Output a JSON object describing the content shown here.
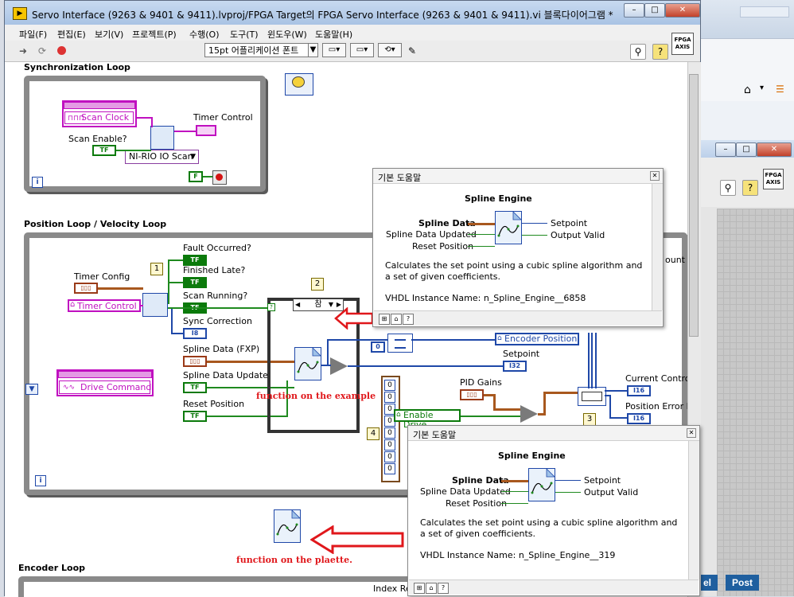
{
  "window": {
    "title": "Servo Interface (9263 & 9401 & 9411).lvproj/FPGA Target의 FPGA Servo Interface (9263 & 9401 & 9411).vi 블록다이어그램 *"
  },
  "menu": [
    "파일(F)",
    "편집(E)",
    "보기(V)",
    "프로젝트(P)",
    "수행(O)",
    "도구(T)",
    "윈도우(W)",
    "도움말(H)"
  ],
  "toolbar": {
    "font": "15pt 어플리케이션 폰트",
    "fpga_badge": "FPGA AXIS"
  },
  "sync_loop": {
    "label": "Synchronization Loop",
    "scan_clock": "Scan Clock",
    "timer_control": "Timer Control",
    "scan_enable": "Scan Enable?",
    "scan_mode": "NI-RIO IO Scan",
    "tf": "TF",
    "f": "F",
    "iter": "i"
  },
  "position_loop": {
    "label": "Position Loop / Velocity Loop",
    "timer_config": "Timer Config",
    "timer_control": "Timer Control",
    "drive_command": "Drive Command",
    "fault_occurred": "Fault Occurred?",
    "finished_late": "Finished Late?",
    "scan_running": "Scan Running?",
    "sync_correction": "Sync Correction",
    "spline_data_fxp": "Spline Data (FXP)",
    "spline_data_updated": "Spline Data Updated",
    "reset_position": "Reset Position",
    "case_selector": "참",
    "frame1": "1",
    "frame2": "2",
    "frame3": "3",
    "frame4": "4",
    "zero": "0",
    "encoder_position": "Encoder Position",
    "setpoint": "Setpoint",
    "pid_gains": "PID Gains",
    "enable_drive": "Enable Drive",
    "current_control": "Current Contro",
    "position_error": "Position Error I",
    "count": "ount",
    "i16": "I16",
    "i32": "I32",
    "i8": "I8",
    "tf": "TF",
    "iter": "i",
    "array_values": [
      "0",
      "0",
      "0",
      "0",
      "0",
      "0",
      "0",
      "0"
    ]
  },
  "annotations": {
    "example": "function on the example",
    "palette": "function on the plaette."
  },
  "encoder_loop": {
    "label": "Encoder Loop",
    "index_reset": "Index Re"
  },
  "help1": {
    "title": "기본 도움말",
    "function": "Spline Engine",
    "inputs": [
      "Spline Data",
      "Spline Data Updated",
      "Reset Position"
    ],
    "outputs": [
      "Setpoint",
      "Output Valid"
    ],
    "description": "Calculates the set point using a cubic spline algorithm and a set of given coefficients.",
    "instance": "VHDL Instance Name: n_Spline_Engine__6858"
  },
  "help2": {
    "title": "기본 도움말",
    "function": "Spline Engine",
    "inputs": [
      "Spline Data",
      "Spline Data Updated",
      "Reset Position"
    ],
    "outputs": [
      "Setpoint",
      "Output Valid"
    ],
    "description": "Calculates the set point using a cubic spline algorithm and a set of given coefficients.",
    "instance": "VHDL Instance Name: n_Spline_Engine__319"
  },
  "background": {
    "btn_cancel": "el",
    "btn_post": "Post",
    "fpga_badge": "FPGA AXIS"
  }
}
